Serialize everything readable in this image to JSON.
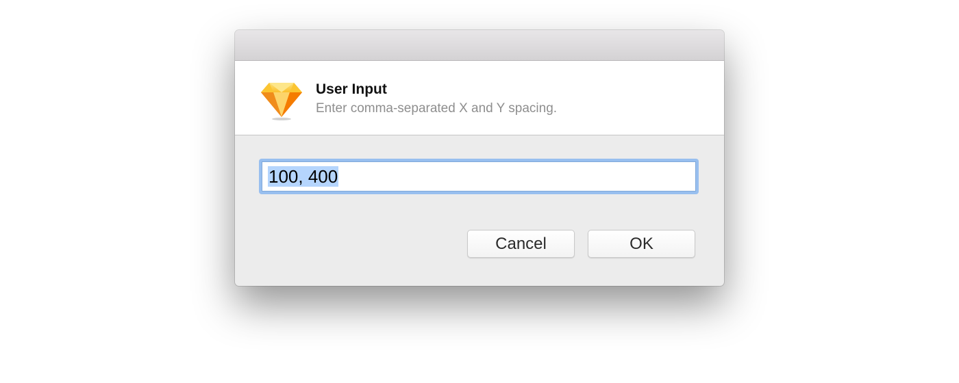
{
  "dialog": {
    "title": "User Input",
    "message": "Enter comma-separated X and Y spacing.",
    "app_icon": "sketch-diamond-icon",
    "input": {
      "value": "100, 400",
      "selected": true
    },
    "buttons": {
      "cancel_label": "Cancel",
      "ok_label": "OK"
    }
  },
  "colors": {
    "focus_ring": "#98bfef",
    "selection": "#b5d5fd",
    "dialog_bg": "#ececec",
    "icon_orange": "#f7a21b",
    "icon_yellow": "#fdd231"
  }
}
